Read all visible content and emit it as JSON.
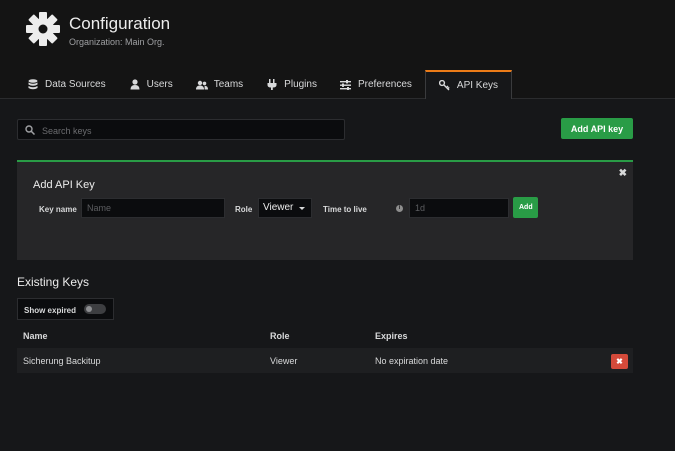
{
  "page": {
    "title": "Configuration",
    "subtitle": "Organization: Main Org."
  },
  "tabs": [
    {
      "label": "Data Sources",
      "icon": "database-icon"
    },
    {
      "label": "Users",
      "icon": "user-icon"
    },
    {
      "label": "Teams",
      "icon": "users-icon"
    },
    {
      "label": "Plugins",
      "icon": "plug-icon"
    },
    {
      "label": "Preferences",
      "icon": "sliders-icon"
    },
    {
      "label": "API Keys",
      "icon": "key-icon",
      "active": true
    }
  ],
  "search": {
    "placeholder": "Search keys"
  },
  "add_api_key_button": "Add API key",
  "panel": {
    "title": "Add API Key",
    "close": "✖",
    "key_name_label": "Key name",
    "key_name_placeholder": "Name",
    "role_label": "Role",
    "role_value": "Viewer",
    "ttl_label": "Time to live",
    "ttl_placeholder": "1d",
    "add_label": "Add"
  },
  "existing": {
    "title": "Existing Keys",
    "show_expired_label": "Show expired",
    "show_expired": false,
    "columns": [
      "Name",
      "Role",
      "Expires"
    ],
    "rows": [
      {
        "name": "Sicherung Backitup",
        "role": "Viewer",
        "expires": "No expiration date"
      }
    ],
    "delete_icon": "✖"
  },
  "colors": {
    "accent": "#eb7b18",
    "primary": "#299c46",
    "danger": "#d44a3a",
    "background": "#161719"
  }
}
